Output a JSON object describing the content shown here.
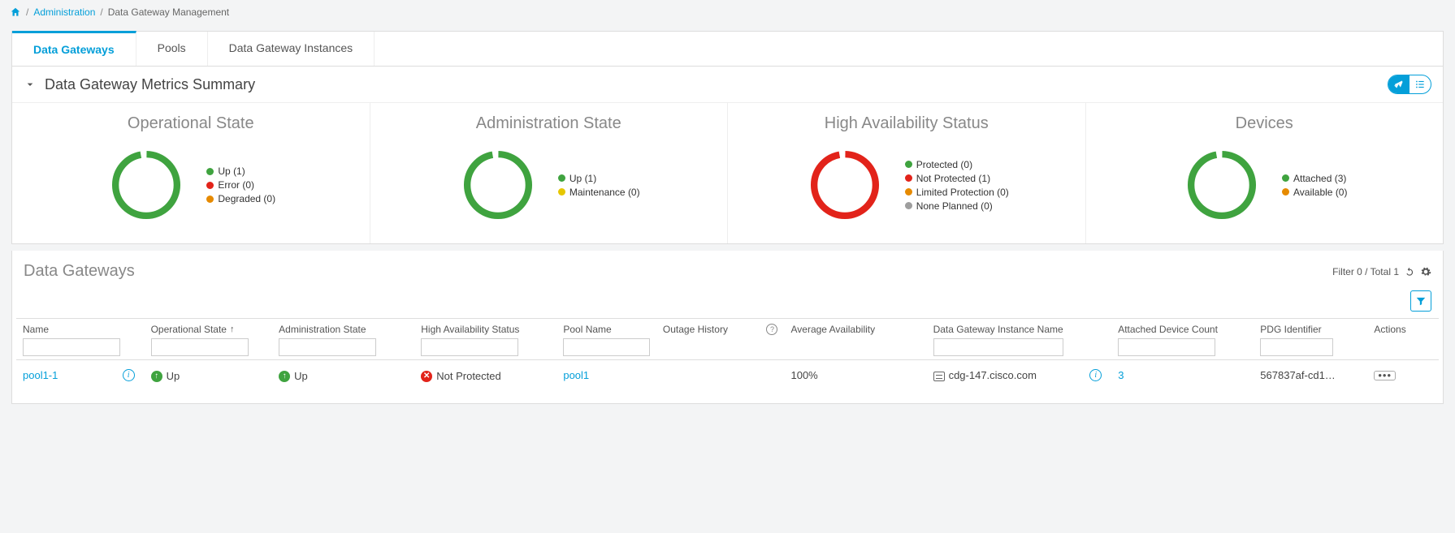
{
  "breadcrumb": {
    "admin": "Administration",
    "current": "Data Gateway Management"
  },
  "tabs": {
    "t1": "Data Gateways",
    "t2": "Pools",
    "t3": "Data Gateway Instances"
  },
  "summary": {
    "title": "Data Gateway Metrics Summary",
    "op": {
      "title": "Operational State",
      "legend": {
        "up": "Up (1)",
        "error": "Error (0)",
        "degraded": "Degraded (0)"
      }
    },
    "admin": {
      "title": "Administration State",
      "legend": {
        "up": "Up (1)",
        "maint": "Maintenance (0)"
      }
    },
    "ha": {
      "title": "High Availability Status",
      "legend": {
        "prot": "Protected (0)",
        "nprot": "Not Protected (1)",
        "lprot": "Limited Protection (0)",
        "none": "None Planned (0)"
      }
    },
    "dev": {
      "title": "Devices",
      "legend": {
        "att": "Attached (3)",
        "avail": "Available (0)"
      }
    }
  },
  "list": {
    "title": "Data Gateways",
    "filter_text": "Filter 0 / Total 1"
  },
  "columns": {
    "name": "Name",
    "op": "Operational State",
    "admin": "Administration State",
    "ha": "High Availability Status",
    "pool": "Pool Name",
    "outage": "Outage History",
    "avg": "Average Availability",
    "inst": "Data Gateway Instance Name",
    "count": "Attached Device Count",
    "pdg": "PDG Identifier",
    "actions": "Actions"
  },
  "row": {
    "name": "pool1-1",
    "op": "Up",
    "admin": "Up",
    "ha": "Not Protected",
    "pool": "pool1",
    "avg": "100%",
    "inst": "cdg-147.cisco.com",
    "count": "3",
    "pdg": "567837af-cd1…"
  },
  "colors": {
    "green": "#3fa33f",
    "red": "#e2231a",
    "orange": "#e68a00",
    "yellow": "#e6c700",
    "grey": "#9e9e9e"
  },
  "chart_data": [
    {
      "type": "pie",
      "title": "Operational State",
      "series": [
        {
          "name": "Up",
          "value": 1,
          "color": "#3fa33f"
        },
        {
          "name": "Error",
          "value": 0,
          "color": "#e2231a"
        },
        {
          "name": "Degraded",
          "value": 0,
          "color": "#e68a00"
        }
      ]
    },
    {
      "type": "pie",
      "title": "Administration State",
      "series": [
        {
          "name": "Up",
          "value": 1,
          "color": "#3fa33f"
        },
        {
          "name": "Maintenance",
          "value": 0,
          "color": "#e6c700"
        }
      ]
    },
    {
      "type": "pie",
      "title": "High Availability Status",
      "series": [
        {
          "name": "Protected",
          "value": 0,
          "color": "#3fa33f"
        },
        {
          "name": "Not Protected",
          "value": 1,
          "color": "#e2231a"
        },
        {
          "name": "Limited Protection",
          "value": 0,
          "color": "#e68a00"
        },
        {
          "name": "None Planned",
          "value": 0,
          "color": "#9e9e9e"
        }
      ]
    },
    {
      "type": "pie",
      "title": "Devices",
      "series": [
        {
          "name": "Attached",
          "value": 3,
          "color": "#3fa33f"
        },
        {
          "name": "Available",
          "value": 0,
          "color": "#e68a00"
        }
      ]
    }
  ]
}
